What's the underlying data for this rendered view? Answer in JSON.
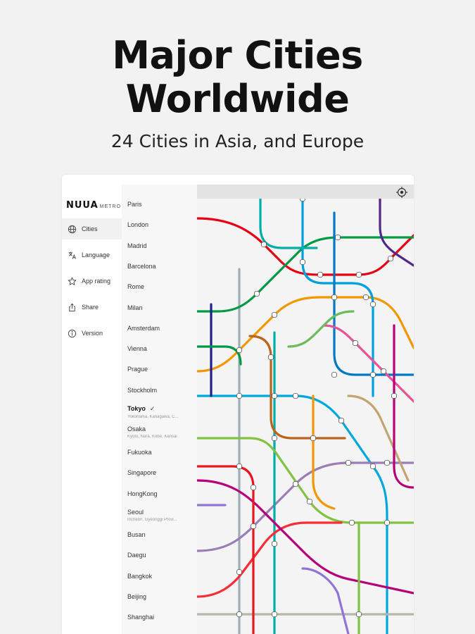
{
  "promo": {
    "title_line1": "Major Cities",
    "title_line2": "Worldwide",
    "subtitle": "24 Cities in Asia, and Europe"
  },
  "app": {
    "logo_main": "NUUA",
    "logo_sub": "METRO"
  },
  "nav": {
    "items": [
      {
        "label": "Cities",
        "icon": "globe-icon",
        "active": true
      },
      {
        "label": "Language",
        "icon": "translate-icon",
        "active": false
      },
      {
        "label": "App rating",
        "icon": "star-icon",
        "active": false
      },
      {
        "label": "Share",
        "icon": "share-icon",
        "active": false
      },
      {
        "label": "Version",
        "icon": "info-icon",
        "active": false
      }
    ]
  },
  "cities": {
    "list": [
      {
        "name": "Paris"
      },
      {
        "name": "London"
      },
      {
        "name": "Madrid"
      },
      {
        "name": "Barcelona"
      },
      {
        "name": "Rome"
      },
      {
        "name": "Milan"
      },
      {
        "name": "Amsterdam"
      },
      {
        "name": "Vienna"
      },
      {
        "name": "Prague"
      },
      {
        "name": "Stockholm"
      },
      {
        "name": "Tokyo",
        "sub": "Yokohama, Kanagawa, C...",
        "selected": true,
        "check": "✓"
      },
      {
        "name": "Osaka",
        "sub": "Kyoto, Nara, Kobe, Kansai"
      },
      {
        "name": "Fukuoka"
      },
      {
        "name": "Singapore"
      },
      {
        "name": "HongKong"
      },
      {
        "name": "Seoul",
        "sub": "Incheon, Gyeonggi Provi..."
      },
      {
        "name": "Busan"
      },
      {
        "name": "Daegu"
      },
      {
        "name": "Bangkok"
      },
      {
        "name": "Beijing"
      },
      {
        "name": "Shanghai"
      }
    ]
  },
  "map": {
    "locate_icon": "crosshair-icon",
    "line_colors": [
      "#e60012",
      "#f39700",
      "#9caeb7",
      "#00a7db",
      "#009944",
      "#9b7cb6",
      "#00ada9",
      "#bb641d",
      "#00a0de",
      "#80c241",
      "#f62e36",
      "#b5b5ac",
      "#0079c2",
      "#e85298",
      "#1d2088",
      "#6cbb5a",
      "#b6007a",
      "#e5171f",
      "#522886",
      "#c1a470",
      "#8f76d6"
    ]
  }
}
